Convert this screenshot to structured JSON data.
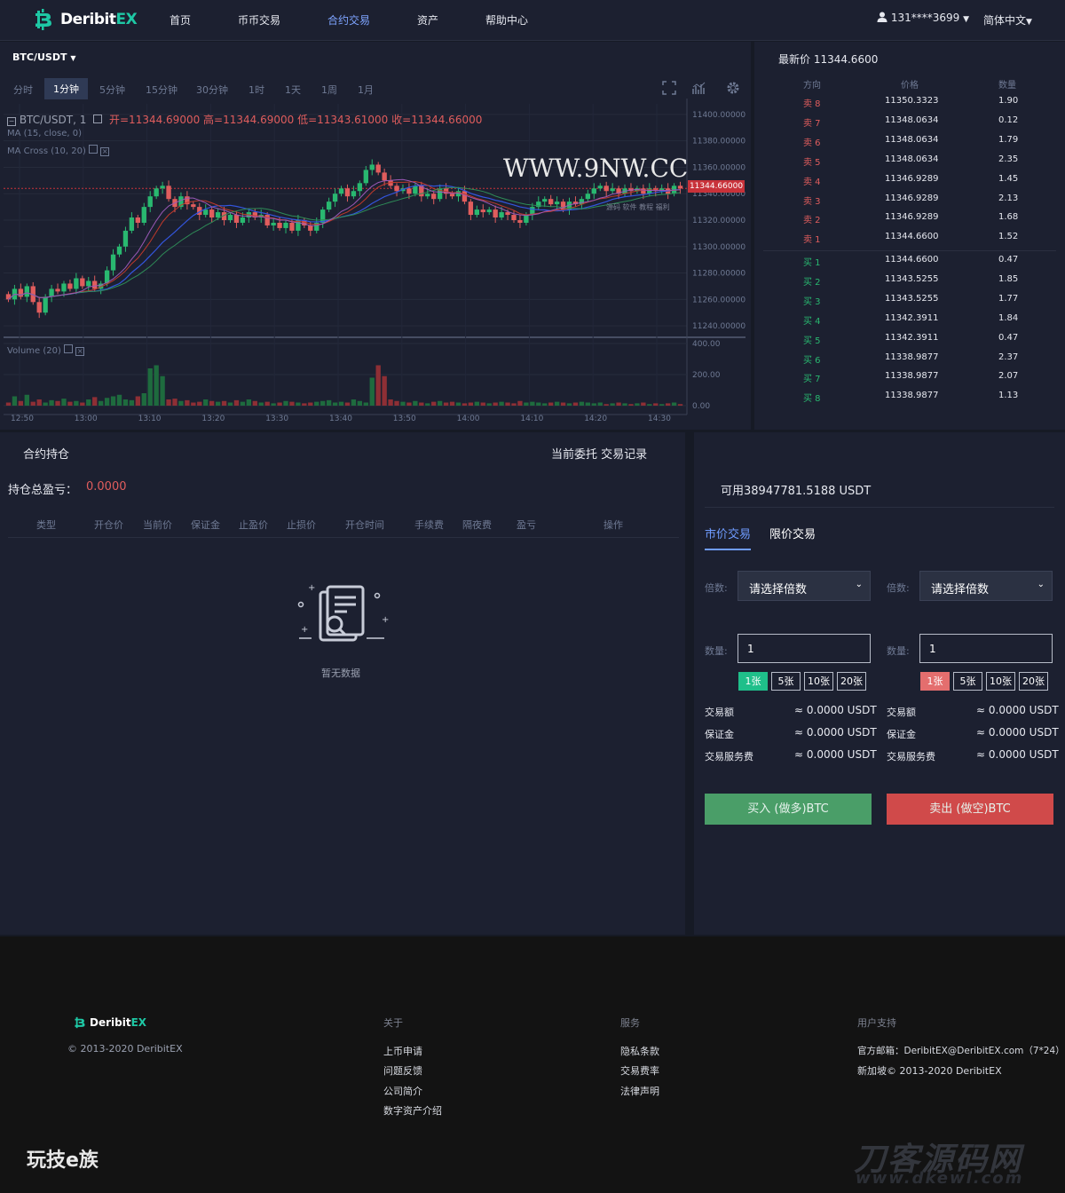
{
  "nav": {
    "brand": "Deribit",
    "brand_suffix": "EX",
    "links": [
      "首页",
      "币币交易",
      "合约交易",
      "资产",
      "帮助中心"
    ],
    "active_link": "合约交易",
    "user": "131****3699",
    "language": "简体中文"
  },
  "chart": {
    "pair": "BTC/USDT",
    "timeframes": [
      "分时",
      "1分钟",
      "5分钟",
      "15分钟",
      "30分钟",
      "1时",
      "1天",
      "1周",
      "1月"
    ],
    "active_timeframe": "1分钟",
    "legend_main": "BTC/USDT, 1",
    "ohlc_open": "开=11344.69000",
    "ohlc_high": "高=11344.69000",
    "ohlc_low": "低=11343.61000",
    "ohlc_close": "收=11344.66000",
    "ma_label": "MA (15, close, 0)",
    "ma_cross_label": "MA Cross (10, 20)",
    "volume_label": "Volume (20)",
    "current_price_tag": "11344.66000",
    "watermark": "WWW.9NW.CC",
    "watermark_sub": "源码 软件 教程 福利"
  },
  "chart_data": {
    "type": "candlestick",
    "price_axis": [
      "11400.00000",
      "11380.00000",
      "11360.00000",
      "11340.00000",
      "11320.00000",
      "11300.00000",
      "11280.00000",
      "11260.00000",
      "11240.00000"
    ],
    "volume_axis": [
      "400.00",
      "200.00",
      "0.00"
    ],
    "time_axis": [
      "12:50",
      "13:00",
      "13:10",
      "13:20",
      "13:30",
      "13:40",
      "13:50",
      "14:00",
      "14:10",
      "14:20",
      "14:30"
    ],
    "ylim": [
      11232,
      11408
    ],
    "volume_ylim": [
      0,
      400
    ],
    "close": [
      11260,
      11268,
      11262,
      11270,
      11258,
      11250,
      11262,
      11268,
      11266,
      11272,
      11268,
      11276,
      11270,
      11274,
      11268,
      11272,
      11282,
      11294,
      11300,
      11312,
      11322,
      11318,
      11330,
      11338,
      11344,
      11346,
      11336,
      11330,
      11338,
      11332,
      11330,
      11324,
      11328,
      11322,
      11326,
      11320,
      11324,
      11318,
      11322,
      11326,
      11322,
      11324,
      11316,
      11318,
      11314,
      11318,
      11312,
      11320,
      11316,
      11312,
      11318,
      11328,
      11334,
      11340,
      11344,
      11338,
      11342,
      11348,
      11358,
      11362,
      11356,
      11350,
      11346,
      11342,
      11344,
      11340,
      11346,
      11338,
      11340,
      11336,
      11344,
      11340,
      11338,
      11342,
      11334,
      11324,
      11328,
      11326,
      11328,
      11322,
      11326,
      11324,
      11320,
      11318,
      11324,
      11330,
      11334,
      11336,
      11332,
      11334,
      11328,
      11334,
      11332,
      11336,
      11340,
      11344,
      11346,
      11342,
      11344,
      11340,
      11344,
      11342,
      11344,
      11340,
      11344,
      11342,
      11344,
      11340,
      11346,
      11344
    ],
    "volume": [
      20,
      60,
      30,
      70,
      25,
      40,
      20,
      35,
      30,
      45,
      25,
      30,
      20,
      40,
      55,
      30,
      50,
      60,
      70,
      40,
      35,
      60,
      80,
      240,
      260,
      190,
      40,
      45,
      30,
      35,
      20,
      25,
      40,
      30,
      25,
      30,
      20,
      35,
      25,
      40,
      30,
      20,
      25,
      15,
      20,
      30,
      25,
      20,
      15,
      20,
      25,
      30,
      35,
      20,
      25,
      20,
      40,
      30,
      20,
      180,
      260,
      190,
      40,
      30,
      25,
      20,
      30,
      20,
      15,
      25,
      30,
      20,
      25,
      20,
      15,
      20,
      25,
      20,
      15,
      20,
      25,
      20,
      15,
      30,
      20,
      25,
      20,
      15,
      20,
      25,
      20,
      15,
      20,
      25,
      20,
      15,
      20,
      10,
      15,
      20,
      15,
      10,
      15,
      20,
      10,
      15,
      10,
      15,
      20,
      10
    ]
  },
  "orderbook": {
    "last_price": "最新价 11344.6600",
    "headers": [
      "方向",
      "价格",
      "数量"
    ],
    "asks": [
      {
        "dir": "卖 8",
        "price": "11350.3323",
        "qty": "1.90"
      },
      {
        "dir": "卖 7",
        "price": "11348.0634",
        "qty": "0.12"
      },
      {
        "dir": "卖 6",
        "price": "11348.0634",
        "qty": "1.79"
      },
      {
        "dir": "卖 5",
        "price": "11348.0634",
        "qty": "2.35"
      },
      {
        "dir": "卖 4",
        "price": "11346.9289",
        "qty": "1.45"
      },
      {
        "dir": "卖 3",
        "price": "11346.9289",
        "qty": "2.13"
      },
      {
        "dir": "卖 2",
        "price": "11346.9289",
        "qty": "1.68"
      },
      {
        "dir": "卖 1",
        "price": "11344.6600",
        "qty": "1.52"
      }
    ],
    "bids": [
      {
        "dir": "买 1",
        "price": "11344.6600",
        "qty": "0.47"
      },
      {
        "dir": "买 2",
        "price": "11343.5255",
        "qty": "1.85"
      },
      {
        "dir": "买 3",
        "price": "11343.5255",
        "qty": "1.77"
      },
      {
        "dir": "买 4",
        "price": "11342.3911",
        "qty": "1.84"
      },
      {
        "dir": "买 5",
        "price": "11342.3911",
        "qty": "0.47"
      },
      {
        "dir": "买 6",
        "price": "11338.9877",
        "qty": "2.37"
      },
      {
        "dir": "买 7",
        "price": "11338.9877",
        "qty": "2.07"
      },
      {
        "dir": "买 8",
        "price": "11338.9877",
        "qty": "1.13"
      }
    ],
    "sell_color": "#e05d5d",
    "buy_color": "#29b870"
  },
  "positions": {
    "title": "合约持仓",
    "tabs": "当前委托 交易记录",
    "pnl_label": "持仓总盈亏：",
    "pnl_value": "0.0000",
    "columns": [
      "类型",
      "开仓价",
      "当前价",
      "保证金",
      "止盈价",
      "止损价",
      "开仓时间",
      "手续费",
      "隔夜费",
      "盈亏",
      "操作"
    ],
    "empty": "暂无数据"
  },
  "trade": {
    "available": "可用38947781.5188 USDT",
    "tab_market": "市价交易",
    "tab_limit": "限价交易",
    "leverage_label": "倍数:",
    "leverage_placeholder": "请选择倍数",
    "qty_label": "数量:",
    "qty_value": "1",
    "qty_buttons": [
      "1张",
      "5张",
      "10张",
      "20张"
    ],
    "info": [
      {
        "k": "交易额",
        "v": "≈ 0.0000 USDT"
      },
      {
        "k": "保证金",
        "v": "≈ 0.0000 USDT"
      },
      {
        "k": "交易服务费",
        "v": "≈ 0.0000 USDT"
      }
    ],
    "buy_label": "买入 (做多)BTC",
    "sell_label": "卖出 (做空)BTC"
  },
  "footer": {
    "brand": "Deribit",
    "brand_suffix": "EX",
    "copyright": "© 2013-2020 DeribitEX",
    "col_about": "关于",
    "about_links": [
      "上币申请",
      "问题反馈",
      "公司简介",
      "数字资产介绍"
    ],
    "col_service": "服务",
    "service_links": [
      "隐私条款",
      "交易费率",
      "法律声明"
    ],
    "col_support": "用户支持",
    "support_email": "官方邮箱：DeribitEX@DeribitEX.com（7*24）",
    "support_copy": "新加坡© 2013-2020 DeribitEX",
    "watermark_left": "玩技e族",
    "watermark_right": "刀客源码网",
    "watermark_right_sub": "www.dkewl.com"
  },
  "colors": {
    "accent": "#6f9cff",
    "up": "#29b870",
    "down": "#e05d5d",
    "brand": "#1ec8a5"
  }
}
